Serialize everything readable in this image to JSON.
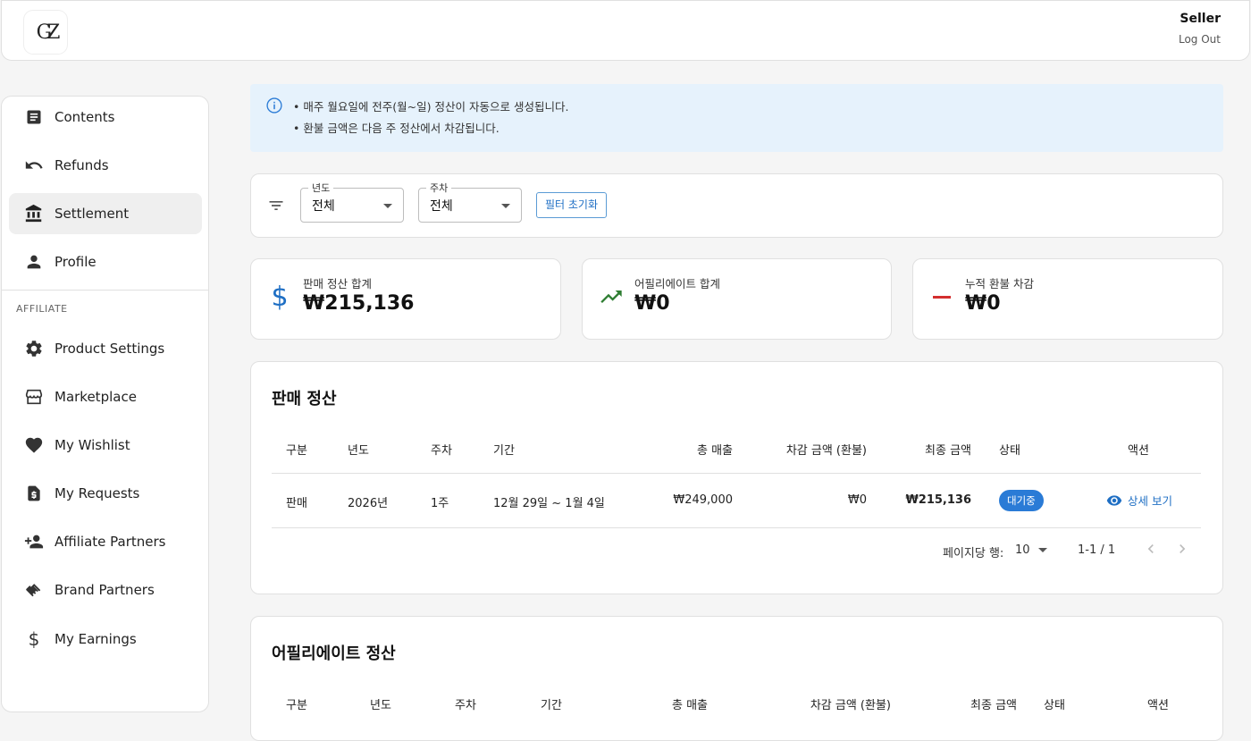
{
  "header": {
    "logo_text": "GZ",
    "user_name": "Seller",
    "logout_label": "Log Out"
  },
  "sidebar": {
    "items": [
      {
        "label": "Contents",
        "icon": "article-icon"
      },
      {
        "label": "Refunds",
        "icon": "undo-icon"
      },
      {
        "label": "Settlement",
        "icon": "bank-icon"
      },
      {
        "label": "Profile",
        "icon": "person-icon"
      }
    ],
    "affiliate_label": "AFFILIATE",
    "affiliate_items": [
      {
        "label": "Product Settings",
        "icon": "gear-icon"
      },
      {
        "label": "Marketplace",
        "icon": "store-icon"
      },
      {
        "label": "My Wishlist",
        "icon": "heart-icon"
      },
      {
        "label": "My Requests",
        "icon": "request-icon"
      },
      {
        "label": "Affiliate Partners",
        "icon": "person-add-icon"
      },
      {
        "label": "Brand Partners",
        "icon": "handshake-icon"
      },
      {
        "label": "My Earnings",
        "icon": "dollar-icon"
      }
    ]
  },
  "info": {
    "line1": "• 매주 월요일에 전주(월~일) 정산이 자동으로 생성됩니다.",
    "line2": "• 환불 금액은 다음 주 정산에서 차감됩니다."
  },
  "filters": {
    "year_legend": "년도",
    "year_value": "전체",
    "week_legend": "주차",
    "week_value": "전체",
    "reset_label": "필터 초기화"
  },
  "stats": [
    {
      "label": "판매 정산 합계",
      "value": "₩215,136",
      "icon": "dollar-icon",
      "color": "#1f6fc4"
    },
    {
      "label": "어필리에이트 합계",
      "value": "₩0",
      "icon": "trending-up-icon",
      "color": "#2e7d32"
    },
    {
      "label": "누적 환불 차감",
      "value": "₩0",
      "icon": "minus-icon",
      "color": "#d32f2f"
    }
  ],
  "sales_settlement": {
    "title": "판매 정산",
    "columns": [
      "구분",
      "년도",
      "주차",
      "기간",
      "총 매출",
      "차감 금액 (환불)",
      "최종 금액",
      "상태",
      "액션"
    ],
    "rows": [
      {
        "type": "판매",
        "year": "2026년",
        "week": "1주",
        "period": "12월 29일 ~ 1월 4일",
        "total": "₩249,000",
        "deduction": "₩0",
        "final": "₩215,136",
        "status": "대기중",
        "action": "상세 보기"
      }
    ],
    "rows_per_page_label": "페이지당 행:",
    "rows_per_page": "10",
    "range": "1-1 / 1"
  },
  "affiliate_settlement": {
    "title": "어필리에이트 정산",
    "columns": [
      "구분",
      "년도",
      "주차",
      "기간",
      "총 매출",
      "차감 금액 (환불)",
      "최종 금액",
      "상태",
      "액션"
    ]
  }
}
